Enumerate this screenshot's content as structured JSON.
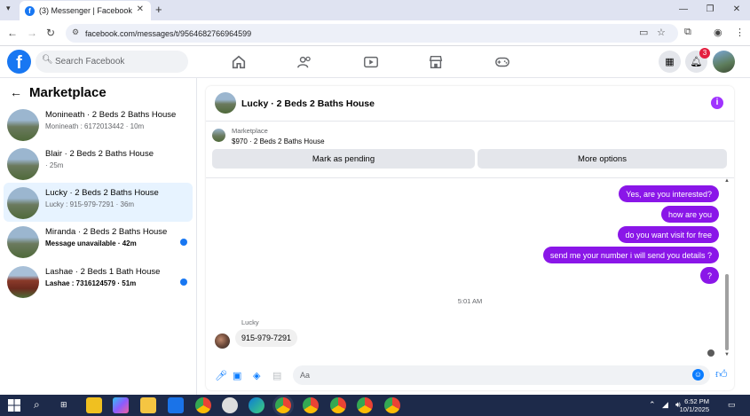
{
  "browser": {
    "tab_title": "(3) Messenger | Facebook",
    "url": "facebook.com/messages/t/9564682766964599"
  },
  "facebook": {
    "search_placeholder": "Search Facebook",
    "notification_count": "3"
  },
  "marketplace": {
    "title": "Marketplace",
    "conversations": [
      {
        "name": "Monineath · 2 Beds 2 Baths House",
        "sub": "Monineath : 6172013442 · 10m",
        "unread": false,
        "active": false
      },
      {
        "name": "Blair · 2 Beds 2 Baths House",
        "sub": " · 25m",
        "unread": false,
        "active": false
      },
      {
        "name": "Lucky · 2 Beds 2 Baths House",
        "sub": "Lucky : 915-979-7291 · 36m",
        "unread": false,
        "active": true
      },
      {
        "name": "Miranda · 2 Beds 2 Baths House",
        "sub": "Message unavailable · 42m",
        "unread": true,
        "active": false
      },
      {
        "name": "Lashae · 2 Beds 1 Bath House",
        "sub": "Lashae : 7316124579 · 51m",
        "unread": true,
        "active": false
      }
    ]
  },
  "chat": {
    "title": "Lucky · 2 Beds 2 Baths House",
    "listing_label": "Marketplace",
    "listing_price": "$970 · 2 Beds 2 Baths House",
    "mark_pending": "Mark as pending",
    "more_options": "More options",
    "outgoing": [
      "Yes, are you interested?",
      "how are you",
      "do you want visit for free",
      "send me your number i will send you details ?",
      "?"
    ],
    "timestamp": "5:01 AM",
    "sender": "Lucky",
    "incoming": "915-979-7291",
    "composer_placeholder": "Aa"
  },
  "taskbar": {
    "time": "6:52 PM",
    "date": "10/1/2025"
  },
  "colors": {
    "facebook_blue": "#1877f2",
    "messenger_purple": "#8a16e8",
    "taskbar": "#1d2a4a"
  }
}
